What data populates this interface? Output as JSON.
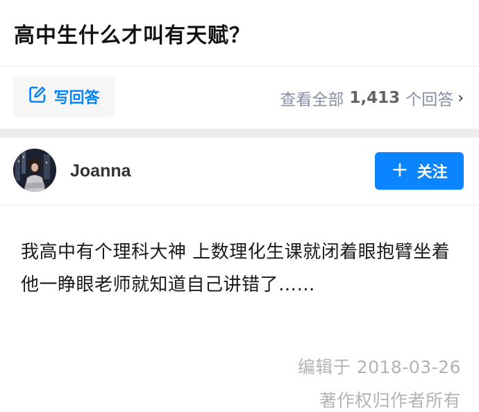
{
  "question": {
    "title": "高中生什么才叫有天赋？"
  },
  "actions": {
    "write_answer_label": "写回答",
    "view_all_prefix": "查看全部",
    "answer_count": "1,413",
    "view_all_suffix": "个回答",
    "chevron": "›"
  },
  "author": {
    "name": "Joanna",
    "follow_label": "关注",
    "follow_icon": "plus-icon"
  },
  "answer": {
    "content": "我高中有个理科大神 上数理化生课就闭着眼抱臂坐着 他一睁眼老师就知道自己讲错了……",
    "edited": "编辑于 2018-03-26",
    "copyright": "著作权归作者所有"
  },
  "colors": {
    "accent": "#0084ff",
    "follow_bg": "#0a84ff",
    "muted": "#b3b3b3"
  }
}
